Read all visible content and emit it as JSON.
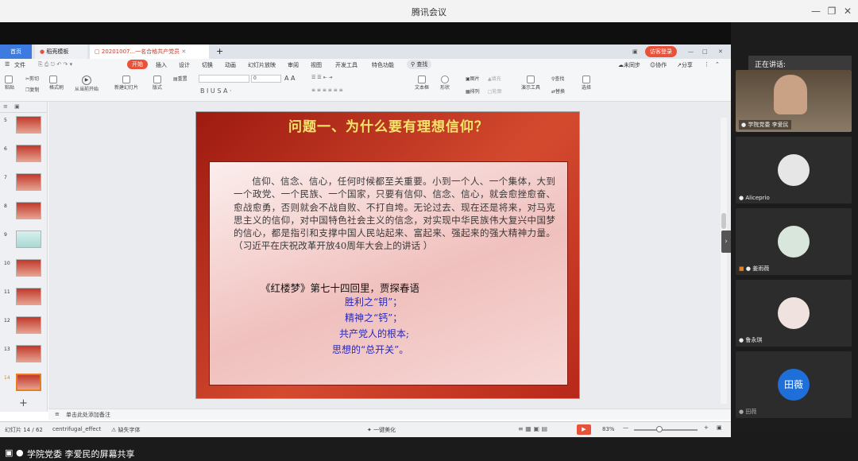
{
  "window": {
    "title": "腾讯会议",
    "minimize_icon": "minimize-icon",
    "maximize_icon": "restore-icon",
    "close_icon": "close-icon"
  },
  "tabs": [
    {
      "label": "首页"
    },
    {
      "label": "稻壳模板"
    },
    {
      "label": "20201007...一名合格共产党员"
    }
  ],
  "tab_add": "+",
  "login_badge": "访客登录",
  "menus": [
    "文件",
    "开始",
    "插入",
    "设计",
    "切换",
    "动画",
    "幻灯片放映",
    "审阅",
    "视图",
    "开发工具",
    "特色功能",
    "查找"
  ],
  "sync": {
    "unsynced": "未同步",
    "collab": "协作",
    "share": "分享"
  },
  "ribbon": {
    "paste": "粘贴",
    "cut": "剪切",
    "copy": "复制",
    "format_painter": "格式刷",
    "from_current": "从当前开始",
    "new_slide": "新建幻灯片",
    "layout": "版式",
    "reset": "重置",
    "font_size": "0",
    "textbox": "文本框",
    "shape": "形状",
    "arrange": "排列",
    "picture": "图片",
    "fill": "填充",
    "outline": "轮廓",
    "presenter": "演示工具",
    "find": "查找",
    "replace": "替换",
    "select": "选择"
  },
  "thumbnails": [
    {
      "num": "5"
    },
    {
      "num": "6"
    },
    {
      "num": "7"
    },
    {
      "num": "8"
    },
    {
      "num": "9"
    },
    {
      "num": "10"
    },
    {
      "num": "11"
    },
    {
      "num": "12"
    },
    {
      "num": "13"
    },
    {
      "num": "14"
    }
  ],
  "panel_add": "+",
  "slide": {
    "title": "问题一、为什么要有理想信仰？",
    "body": "信仰、信念、信心，任何时候都至关重要。小到一个人、一个集体，大到一个政党、一个民族、一个国家，只要有信仰、信念、信心，就会愈挫愈奋、愈战愈勇，否则就会不战自败、不打自垮。无论过去、现在还是将来，对马克思主义的信仰，对中国特色社会主义的信念，对实现中华民族伟大复兴中国梦的信心，都是指引和支撑中国人民站起来、富起来、强起来的强大精神力量。（习近平在庆祝改革开放40周年大会上的讲话 ）",
    "quote": "《红楼梦》第七十四回里，贾探春语",
    "lines": [
      "胜利之“钥”；",
      "精神之“钙”；",
      "共产党人的根本;",
      "思想的“总开关”。"
    ]
  },
  "notes_placeholder": "单击此处添加备注",
  "status": {
    "slide_counter": "幻灯片 14 / 62",
    "theme": "centrifugal_effect",
    "missing_font": "缺失字体",
    "beautify": "一键美化",
    "zoom": "83%"
  },
  "sidebar": {
    "speaking_label": "正在讲话:",
    "participants": [
      {
        "name": "学院党委 李爱民",
        "type": "video"
      },
      {
        "name": "Aliceprio",
        "type": "avatar"
      },
      {
        "name": "姜雨薇",
        "type": "avatar"
      },
      {
        "name": "鲁永琪",
        "type": "avatar"
      },
      {
        "name": "田薇",
        "type": "initials",
        "initials": "田薇"
      }
    ]
  },
  "screen_share_label": "学院党委 李爱民的屏幕共享",
  "colors": {
    "accent": "#e8523a",
    "slide_title": "#f7e56b",
    "slide_lines": "#2727b8",
    "initials_avatar": "#1e6fd9"
  }
}
